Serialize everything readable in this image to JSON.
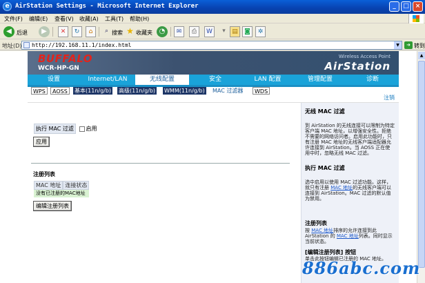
{
  "window": {
    "title": "AirStation Settings - Microsoft Internet Explorer"
  },
  "menu": [
    "文件(F)",
    "编辑(E)",
    "查看(V)",
    "收藏(A)",
    "工具(T)",
    "帮助(H)"
  ],
  "toolbar": {
    "back": "后退",
    "search": "搜索",
    "favorites": "收藏夹"
  },
  "address": {
    "label": "地址(D)",
    "url": "http://192.168.11.1/index.html",
    "go": "转到"
  },
  "banner": {
    "brand": "BUFFALO",
    "model": "WCR-HP-GN",
    "product_tag": "Wireless Access Point",
    "product": "AirStation"
  },
  "nav": [
    "设置",
    "Internet/LAN",
    "无线配置",
    "安全",
    "LAN 配置",
    "管理配置",
    "诊断"
  ],
  "subnav": [
    "WPS",
    "AOSS",
    "基本(11n/g/b)",
    "高级(11n/g/b)",
    "WMM(11n/g/b)",
    "MAC 过滤器",
    "WDS"
  ],
  "logout": "注销",
  "form": {
    "exec_label": "执行 MAC 过滤",
    "enable_label": "启用",
    "apply_button": "应用"
  },
  "registered": {
    "title": "注册列表",
    "col_mac": "MAC 地址",
    "col_status": "连接状态",
    "empty": "没有已注册的MAC地址",
    "edit_button": "编辑注册列表"
  },
  "help": {
    "h1": "无线 MAC 过滤",
    "p1": "到 AirStation 的无线连接可以限制为特定客户端 MAC 地址，以增强安全性。拒绝不需要的网络访问者。启用此功能时，只有注册 MAC 地址的无线客户端适配器允许连接到 AirStation。当 AOSS 正在使用中时，忽略无线 MAC 过滤。",
    "h2": "执行 MAC 过滤",
    "p2_a": "选中启用以使用 MAC 过滤功能。这样，就只有注册 ",
    "p2_link": "MAC 地址",
    "p2_b": "的无线客户端可以连接到 AirStation。MAC 过滤的默认值为禁用。",
    "h3": "注册列表",
    "p3_a": "按 ",
    "p3_link1": "MAC 地址",
    "p3_b": "排序的允许连接到此 AirStation 的 ",
    "p3_link2": "MAC 地址",
    "p3_c": "列表。同时显示当前状态。",
    "h4": "[编辑注册列表] 按钮",
    "p4": "单击此按钮编辑已注册的 MAC 地址。"
  },
  "watermark": "886abc.com"
}
